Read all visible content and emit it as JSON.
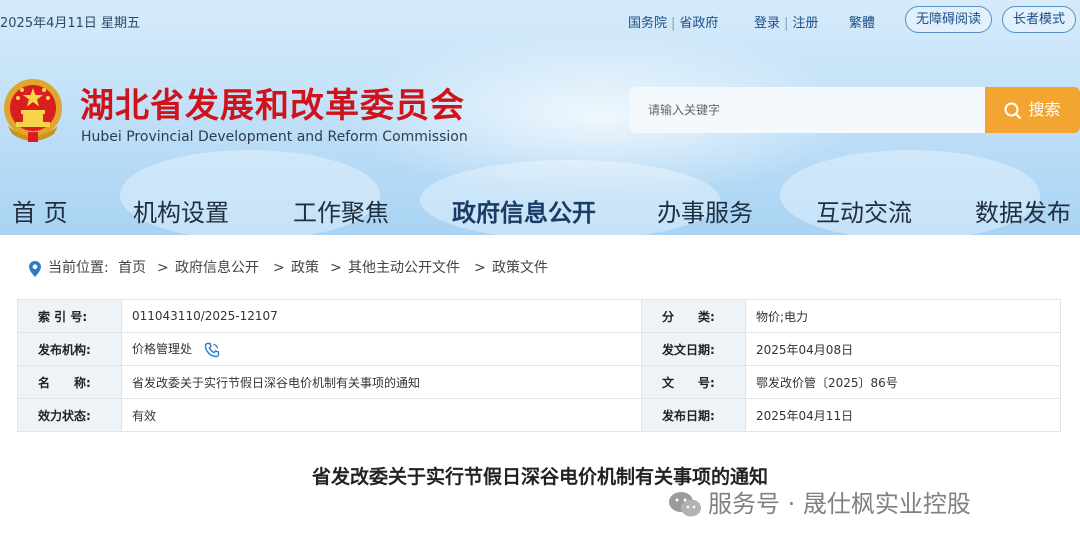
{
  "topbar": {
    "date": "2025年4月11日 星期五",
    "link_guowuyuan": "国务院",
    "link_provincial_gov": "省政府",
    "link_login": "登录",
    "link_register": "注册",
    "link_traditional": "繁體",
    "btn_accessible": "无障碍阅读",
    "btn_elder": "长者模式"
  },
  "brand": {
    "title": "湖北省发展和改革委员会",
    "subtitle": "Hubei Provincial Development and Reform Commission",
    "title_color": "#d0121b"
  },
  "search": {
    "placeholder": "请输入关键字",
    "button_label": "搜索",
    "button_color": "#f2a531"
  },
  "nav": {
    "items": [
      "首 页",
      "机构设置",
      "工作聚焦",
      "政府信息公开",
      "办事服务",
      "互动交流",
      "数据发布"
    ],
    "active": "政府信息公开"
  },
  "breadcrumb": {
    "prefix": "当前位置:",
    "items": [
      "首页",
      "政府信息公开",
      "政策",
      "其他主动公开文件",
      "政策文件"
    ],
    "separator": ">"
  },
  "meta": {
    "index_label": "索 引 号:",
    "index_value": "011043110/2025-12107",
    "category_label": "分　　类:",
    "category_value": "物价;电力",
    "issuer_label": "发布机构:",
    "issuer_value": "价格管理处",
    "doc_date_label": "发文日期:",
    "doc_date_value": "2025年04月08日",
    "name_label": "名　　称:",
    "name_value": "省发改委关于实行节假日深谷电价机制有关事项的通知",
    "doc_no_label": "文　　号:",
    "doc_no_value": "鄂发改价管〔2025〕86号",
    "status_label": "效力状态:",
    "status_value": "有效",
    "pub_date_label": "发布日期:",
    "pub_date_value": "2025年04月11日"
  },
  "document": {
    "title": "省发改委关于实行节假日深谷电价机制有关事项的通知"
  },
  "watermark": {
    "text": "服务号 · 晟仕枫实业控股"
  }
}
